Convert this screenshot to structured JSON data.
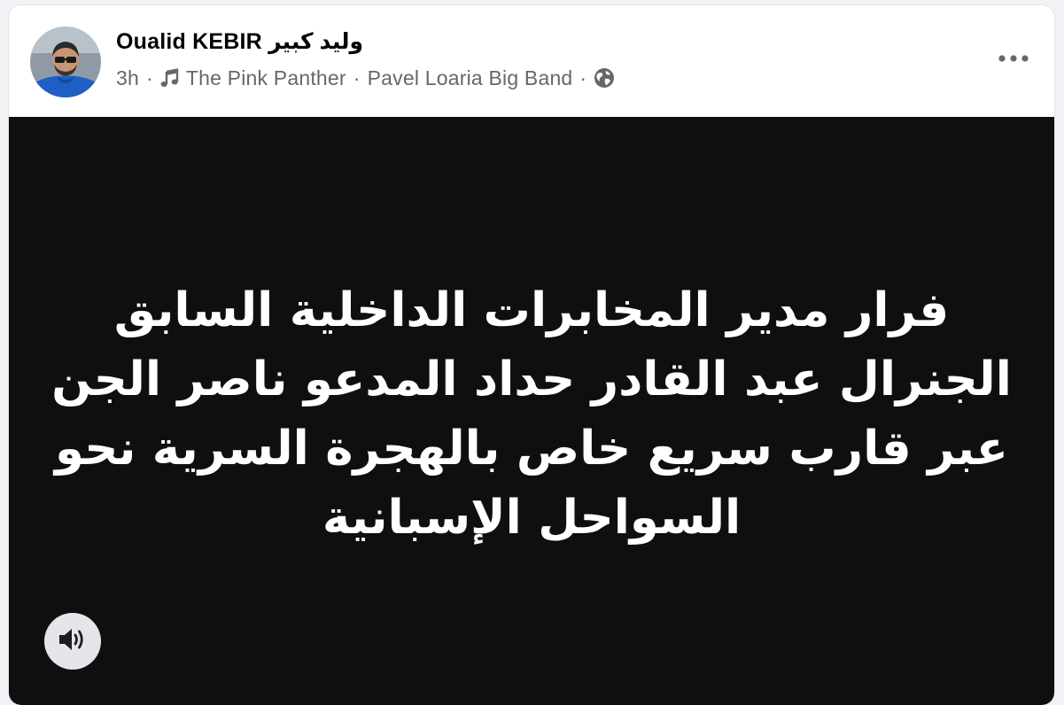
{
  "post": {
    "author_name": "Oualid KEBIR وليد كبير",
    "time": "3h",
    "song_title": "The Pink Panther",
    "song_artist": "Pavel Loaria Big Band",
    "separator": "·",
    "privacy_icon": "globe-icon",
    "music_icon": "music-note-icon",
    "more_icon": "more-horizontal-icon"
  },
  "media": {
    "background_color": "#0f0f0f",
    "text_lines": [
      "فرار مدير المخابرات الداخلية السابق",
      "الجنرال عبد القادر حداد المدعو ناصر الجن",
      "عبر قارب سريع خاص بالهجرة السرية نحو",
      "السواحل الإسبانية"
    ],
    "sound_icon": "speaker-on-icon"
  },
  "colors": {
    "secondary_text": "#65676b",
    "primary_text": "#050505",
    "sound_button_bg": "#e4e6eb"
  }
}
